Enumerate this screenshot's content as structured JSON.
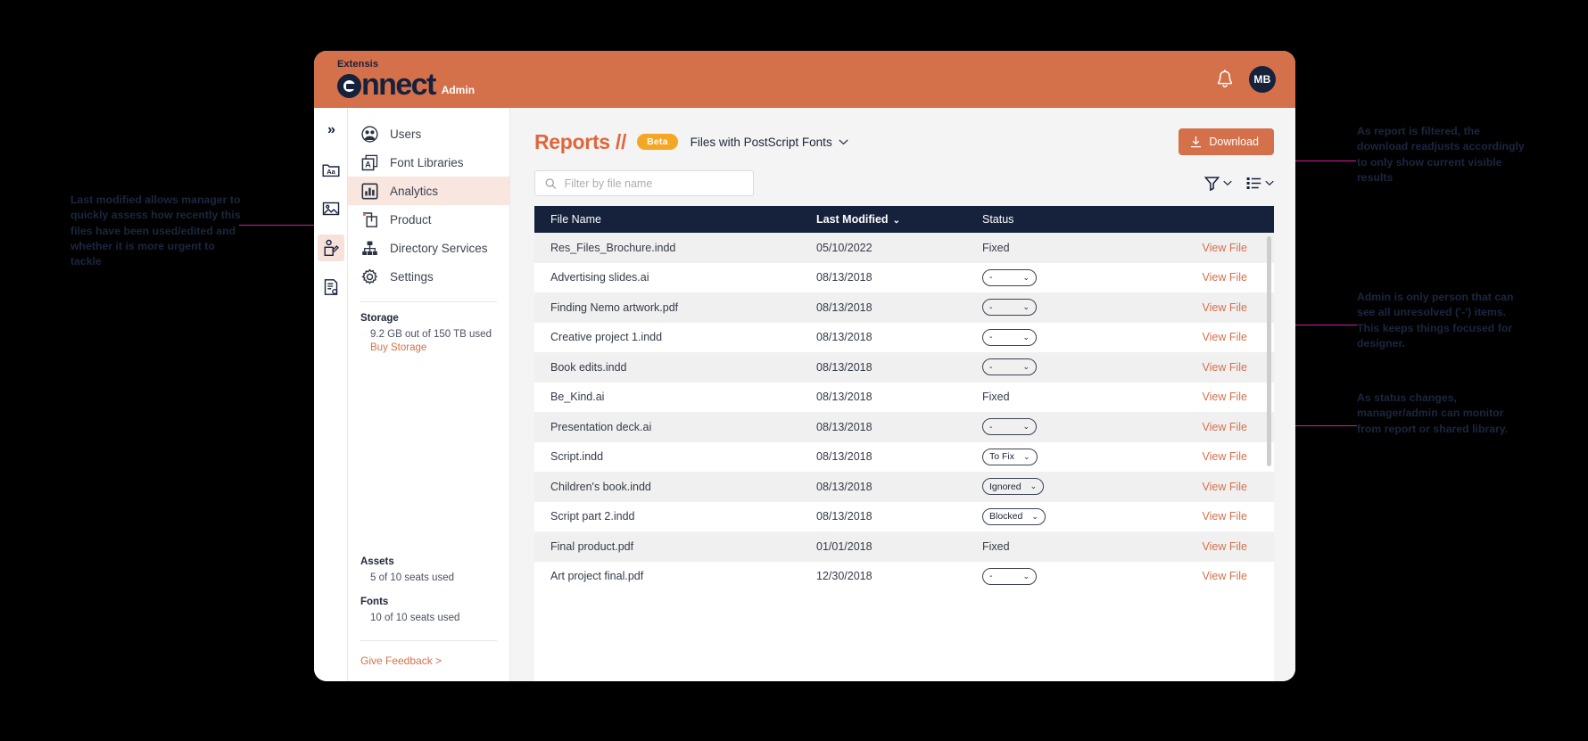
{
  "app": {
    "brand_top": "Extensis",
    "brand_logo_pre": "c",
    "brand_logo_post": "nnect",
    "brand_admin": "Admin",
    "avatar_initials": "MB"
  },
  "rail": {
    "collapse_label": "»",
    "items": [
      {
        "name": "font-folder-icon"
      },
      {
        "name": "image-icon"
      },
      {
        "name": "user-edit-icon"
      },
      {
        "name": "report-icon"
      }
    ]
  },
  "sidebar": {
    "items": [
      {
        "label": "Users",
        "icon": "users-icon"
      },
      {
        "label": "Font Libraries",
        "icon": "font-library-icon"
      },
      {
        "label": "Analytics",
        "icon": "analytics-icon"
      },
      {
        "label": "Product",
        "icon": "product-icon"
      },
      {
        "label": "Directory Services",
        "icon": "directory-services-icon"
      },
      {
        "label": "Settings",
        "icon": "gear-icon"
      }
    ],
    "storage": {
      "title": "Storage",
      "usage": "9.2 GB out of 150 TB used",
      "buy_link": "Buy Storage"
    },
    "assets": {
      "title": "Assets",
      "usage": "5 of 10 seats used"
    },
    "fonts": {
      "title": "Fonts",
      "usage": "10 of 10 seats used"
    },
    "feedback_link": "Give Feedback >"
  },
  "main": {
    "page_title": "Reports //",
    "beta_badge": "Beta",
    "report_name": "Files with PostScript Fonts",
    "download_label": "Download",
    "search_placeholder": "Filter by file name",
    "search_value": "",
    "filter_tool": "filter-icon",
    "columns_tool": "list-view-icon"
  },
  "table": {
    "columns": [
      "File Name",
      "Last Modified",
      "Status"
    ],
    "sorted_column": "Last Modified",
    "action_label": "View File",
    "rows": [
      {
        "file": "Res_Files_Brochure.indd",
        "modified": "05/10/2022",
        "status": "Fixed",
        "status_type": "plain"
      },
      {
        "file": "Advertising slides.ai",
        "modified": "08/13/2018",
        "status": "-",
        "status_type": "chip"
      },
      {
        "file": "Finding Nemo artwork.pdf",
        "modified": "08/13/2018",
        "status": "-",
        "status_type": "chip"
      },
      {
        "file": "Creative project 1.indd",
        "modified": "08/13/2018",
        "status": "-",
        "status_type": "chip"
      },
      {
        "file": "Book edits.indd",
        "modified": "08/13/2018",
        "status": "-",
        "status_type": "chip"
      },
      {
        "file": "Be_Kind.ai",
        "modified": "08/13/2018",
        "status": "Fixed",
        "status_type": "plain"
      },
      {
        "file": "Presentation deck.ai",
        "modified": "08/13/2018",
        "status": "-",
        "status_type": "chip"
      },
      {
        "file": "Script.indd",
        "modified": "08/13/2018",
        "status": "To Fix",
        "status_type": "chip"
      },
      {
        "file": "Children's book.indd",
        "modified": "08/13/2018",
        "status": "Ignored",
        "status_type": "chip"
      },
      {
        "file": "Script part 2.indd",
        "modified": "08/13/2018",
        "status": "Blocked",
        "status_type": "chip"
      },
      {
        "file": "Final product.pdf",
        "modified": "01/01/2018",
        "status": "Fixed",
        "status_type": "plain"
      },
      {
        "file": "Art project final.pdf",
        "modified": "12/30/2018",
        "status": "-",
        "status_type": "chip"
      }
    ]
  },
  "annotations": {
    "left": "Last modified allows manager to quickly assess how recently this files have been used/edited and whether it is more urgent to tackle",
    "right_1": "As report is filtered, the download readjusts accordingly to only show current visible results",
    "right_2": "Admin is only person that can see all unresolved ('-') items. This keeps things focused for designer.",
    "right_3": "As status changes, manager/admin can monitor from report or shared library."
  },
  "colors": {
    "brand_orange": "#d4714b",
    "title_orange": "#e0663c",
    "navy": "#16213c",
    "beta_amber": "#f5a623",
    "annotation_magenta": "#d81b9c"
  }
}
